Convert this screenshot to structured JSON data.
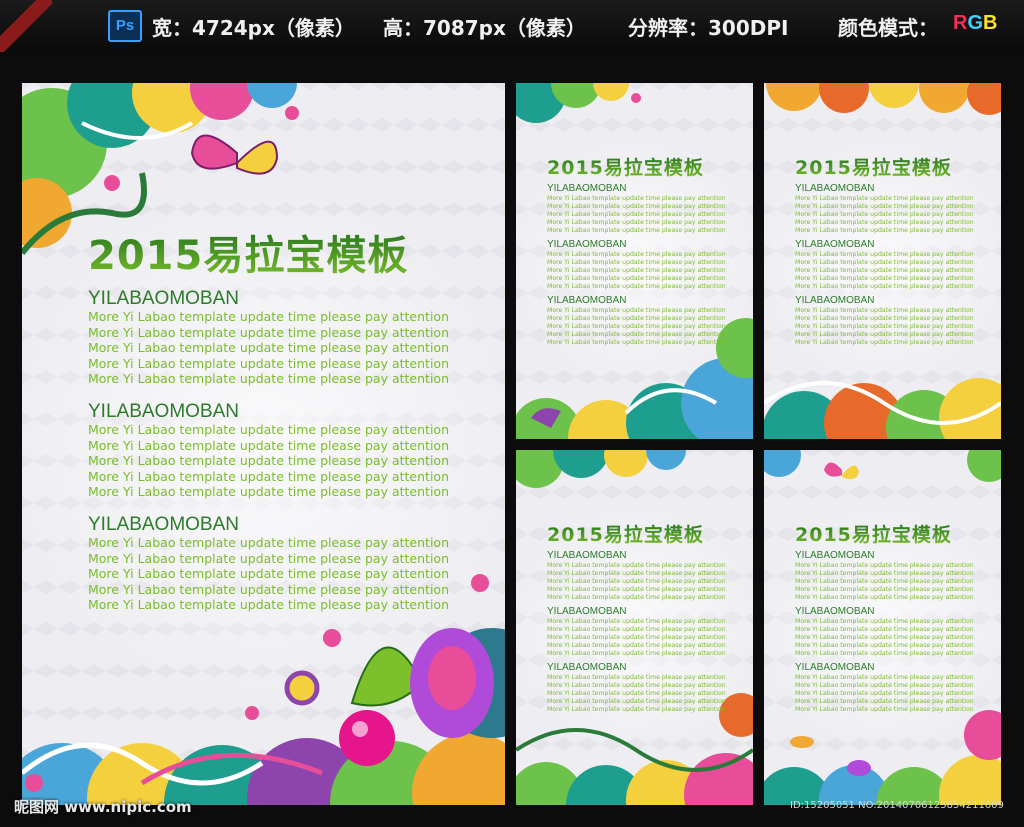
{
  "header": {
    "ps_label": "Ps",
    "width": "宽：4724px（像素）",
    "height": "高：7087px（像素）",
    "resolution": "分辨率：300DPI",
    "color_mode": "颜色模式：",
    "rgb_r": "R",
    "rgb_g": "G",
    "rgb_b": "B"
  },
  "template": {
    "title": "2015易拉宝模板",
    "heading": "YILABAOMOBAN",
    "line": "More Yi Labao template update time please pay attention"
  },
  "footer": {
    "watermark": "昵图网 www.nipic.com",
    "id": "ID:15205051 NO:20140706125854211609"
  },
  "colors": {
    "title_green": "#2f8a2a",
    "text_green": "#7bbd2a",
    "background": "#0c0c0c"
  }
}
